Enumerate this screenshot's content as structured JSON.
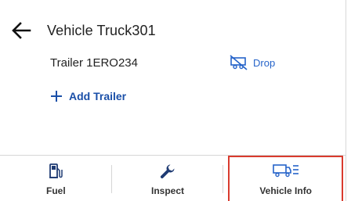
{
  "header": {
    "title": "Vehicle Truck301"
  },
  "trailer": {
    "label": "Trailer 1ERO234",
    "drop_label": "Drop"
  },
  "actions": {
    "add_trailer_label": "Add Trailer"
  },
  "tabs": [
    {
      "label": "Fuel",
      "icon": "fuel-icon"
    },
    {
      "label": "Inspect",
      "icon": "wrench-icon"
    },
    {
      "label": "Vehicle Info",
      "icon": "vehicle-info-icon",
      "active": true
    }
  ],
  "colors": {
    "accent": "#2563c9",
    "active_border": "#d93b2e"
  }
}
